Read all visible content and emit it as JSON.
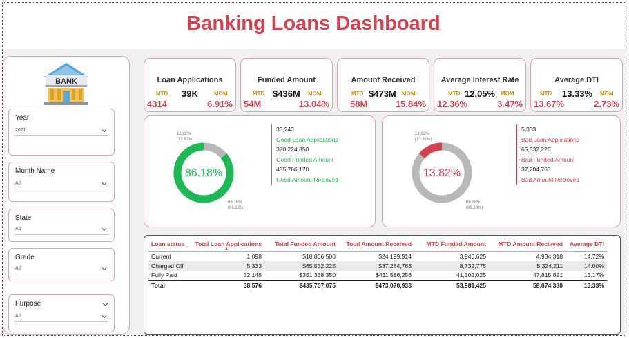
{
  "title": "Banking Loans Dashboard",
  "bank_logo_text": "BANK",
  "slicers": [
    {
      "label": "Year",
      "value": "2021"
    },
    {
      "label": "Month Name",
      "value": "All"
    },
    {
      "label": "State",
      "value": "All"
    },
    {
      "label": "Grade",
      "value": "All"
    },
    {
      "label": "Purpose",
      "value": "All"
    }
  ],
  "kpis": [
    {
      "title": "Loan Applications",
      "mtd_label": "MTD",
      "main": "39K",
      "mom_label": "MOM",
      "mtd_value": "4314",
      "mom_value": "6.91%"
    },
    {
      "title": "Funded Amount",
      "mtd_label": "MTD",
      "main": "$436M",
      "mom_label": "MOM",
      "mtd_value": "54M",
      "mom_value": "13.04%"
    },
    {
      "title": "Amount Received",
      "mtd_label": "MTD",
      "main": "$473M",
      "mom_label": "MOM",
      "mtd_value": "58M",
      "mom_value": "15.84%"
    },
    {
      "title": "Average Interest Rate",
      "mtd_label": "MTD",
      "main": "12.05%",
      "mom_label": "MOM",
      "mtd_value": "12.36%",
      "mom_value": "3.47%"
    },
    {
      "title": "Average DTI",
      "mtd_label": "MTD",
      "main": "13.33%",
      "mom_label": "MOM",
      "mtd_value": "13.67%",
      "mom_value": "2.73%"
    }
  ],
  "good_loans": {
    "center_label": "86.18%",
    "slice_top_label": "13.82%",
    "slice_top_sub": "(13.82%)",
    "slice_bottom_label": "86.18%",
    "slice_bottom_sub": "(86.18%)",
    "applications_value": "33,243",
    "applications_label": "Good Loan Applications",
    "funded_value": "370,224,850",
    "funded_label": "Good Funded Amount",
    "received_value": "435,786,170",
    "received_label": "Good Amount Recieved",
    "color": "#1db954"
  },
  "bad_loans": {
    "center_label": "13.82%",
    "slice_top_label": "13.82%",
    "slice_top_sub": "(13.82%)",
    "slice_bottom_label": "86.18%",
    "slice_bottom_sub": "(86.18%)",
    "applications_value": "5,333",
    "applications_label": "Bad Loan Applications",
    "funded_value": "65,532,225",
    "funded_label": "Bad Funded Amount",
    "received_value": "37,284,763",
    "received_label": "Bad Amount Recieved",
    "color": "#d7404d"
  },
  "chart_data": [
    {
      "type": "pie",
      "categories": [
        "Good Loan",
        "Bad Loan"
      ],
      "values": [
        86.18,
        13.82
      ],
      "highlight": "Good Loan"
    },
    {
      "type": "pie",
      "categories": [
        "Bad Loan",
        "Good Loan"
      ],
      "values": [
        13.82,
        86.18
      ],
      "highlight": "Bad Loan"
    }
  ],
  "table": {
    "headers": [
      "Loan status",
      "Total Loan Applications",
      "Total Funded Amount",
      "Total Amount Received",
      "MTD Funded Amount",
      "MTD Amount Recieved",
      "Average DTI"
    ],
    "rows": [
      [
        "Current",
        "1,098",
        "$18,866,500",
        "$24,199,914",
        "3,946,625",
        "4,934,318",
        "14.72%"
      ],
      [
        "Charged Off",
        "5,333",
        "$65,532,225",
        "$37,284,763",
        "8,732,775",
        "5,324,211",
        "14.00%"
      ],
      [
        "Fully Paid",
        "32,145",
        "$351,358,350",
        "$411,586,256",
        "41,302,025",
        "47,815,851",
        "13.17%"
      ]
    ],
    "total": [
      "Total",
      "38,576",
      "$435,757,075",
      "$473,070,933",
      "53,981,425",
      "58,074,380",
      "13.33%"
    ]
  },
  "colors": {
    "accent": "#d7404d",
    "good": "#1db954",
    "gold": "#c79413",
    "grey": "#b8b8b8"
  }
}
